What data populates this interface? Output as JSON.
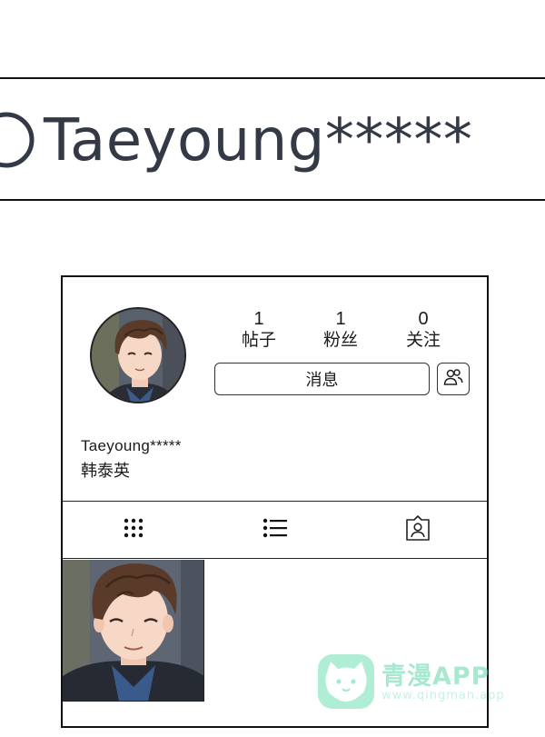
{
  "search": {
    "query": "Taeyoung*****",
    "icon": "search-icon"
  },
  "profile": {
    "stats": [
      {
        "value": "1",
        "label": "帖子"
      },
      {
        "value": "1",
        "label": "粉丝"
      },
      {
        "value": "0",
        "label": "关注"
      }
    ],
    "message_label": "消息",
    "username": "Taeyoung*****",
    "display_name": "韩泰英",
    "tabs": [
      {
        "icon": "grid-icon"
      },
      {
        "icon": "list-icon"
      },
      {
        "icon": "tagged-user-icon"
      }
    ]
  },
  "watermark": {
    "title": "青漫APP",
    "url": "www.qingman.app"
  },
  "colors": {
    "border": "#111111",
    "query_text": "#333a45",
    "watermark": "#5fd8a8"
  }
}
